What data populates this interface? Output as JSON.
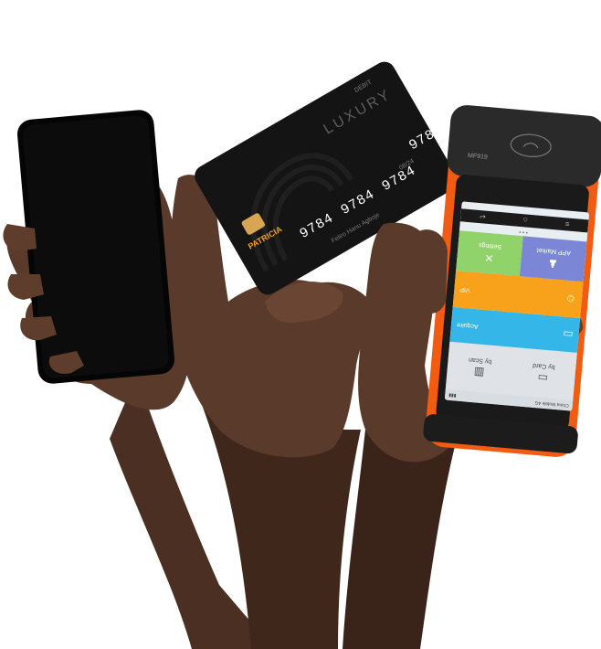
{
  "scene": {
    "background": "#ffffff",
    "skin_color": "#5a3a2a",
    "skin_shadow": "#3f271b",
    "phone_color": "#0a0a0a",
    "card_color": "#141414",
    "pos_orange": "#f25b12"
  },
  "card": {
    "brand": "PATRICIA",
    "type": "DEBIT",
    "tier": "LUXURY",
    "number_groups": [
      "9784",
      "9784",
      "9784",
      "9784"
    ],
    "expiry": "08/24",
    "holder": "Feliro Hanu Agboje"
  },
  "pos": {
    "model": "MF919",
    "status_text": "China Mobile 4G",
    "tiles": {
      "scan": "by Scan",
      "card": "by Card",
      "acquire": "Acquire",
      "vip": "VIP",
      "market": "APP Market",
      "settings": "Settings"
    },
    "colors": {
      "blue": "#35b6e8",
      "orange": "#f7a21a",
      "purple": "#7c86d6",
      "green": "#8fd36a"
    }
  }
}
